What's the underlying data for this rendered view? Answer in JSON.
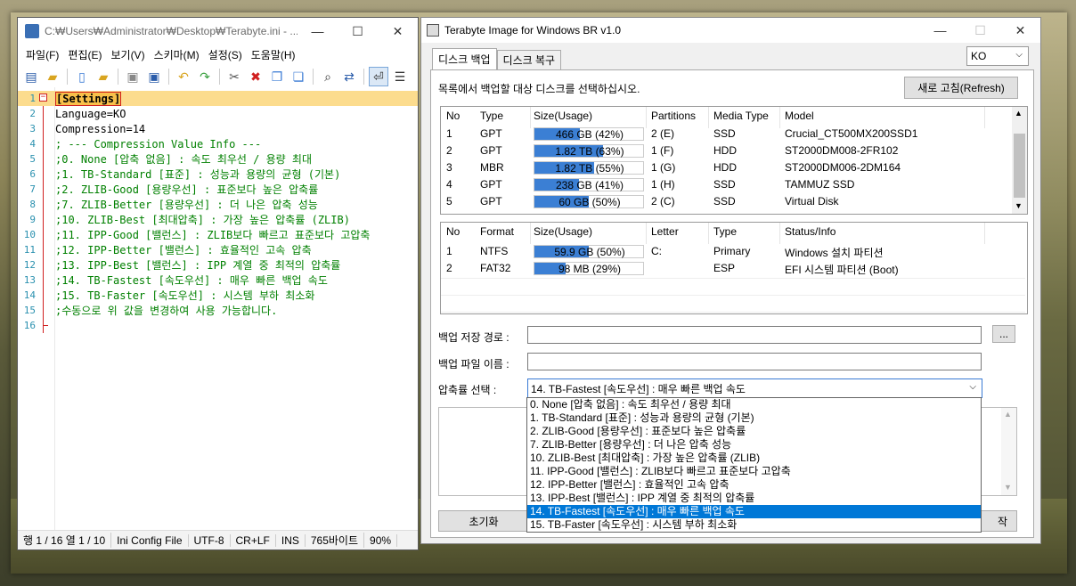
{
  "notepad": {
    "title": "C:₩Users₩Administrator₩Desktop₩Terabyte.ini - ...",
    "menu": [
      "파일(F)",
      "편집(E)",
      "보기(V)",
      "스키마(M)",
      "설정(S)",
      "도움말(H)"
    ],
    "lines": [
      {
        "n": "1",
        "text": "[Settings]"
      },
      {
        "n": "2",
        "text": "Language=KO"
      },
      {
        "n": "3",
        "text": "Compression=14"
      },
      {
        "n": "4",
        "text": "; --- Compression Value Info ---"
      },
      {
        "n": "5",
        "text": ";0. None [압축 없음] : 속도 최우선 / 용량 최대"
      },
      {
        "n": "6",
        "text": ";1. TB-Standard [표준] : 성능과 용량의 균형 (기본)"
      },
      {
        "n": "7",
        "text": ";2. ZLIB-Good [용량우선] : 표준보다 높은 압축률"
      },
      {
        "n": "8",
        "text": ";7. ZLIB-Better [용량우선] : 더 나은 압축 성능"
      },
      {
        "n": "9",
        "text": ";10. ZLIB-Best [최대압축] : 가장 높은 압축률 (ZLIB)"
      },
      {
        "n": "10",
        "text": ";11. IPP-Good [밸런스] : ZLIB보다 빠르고 표준보다 고압축"
      },
      {
        "n": "11",
        "text": ";12. IPP-Better [밸런스] : 효율적인 고속 압축"
      },
      {
        "n": "12",
        "text": ";13. IPP-Best [밸런스] : IPP 계열 중 최적의 압축률"
      },
      {
        "n": "13",
        "text": ";14. TB-Fastest [속도우선] : 매우 빠른 백업 속도"
      },
      {
        "n": "14",
        "text": ";15. TB-Faster [속도우선] : 시스템 부하 최소화"
      },
      {
        "n": "15",
        "text": ";수동으로 위 값을 변경하여 사용 가능합니다."
      },
      {
        "n": "16",
        "text": ""
      }
    ],
    "status": [
      "행 1 / 16  열 1 / 10",
      "Ini Config File",
      "UTF-8",
      "CR+LF",
      "INS",
      "765바이트",
      "90%"
    ]
  },
  "tbi": {
    "title": "Terabyte Image for Windows BR v1.0",
    "tabs": [
      "디스크 백업",
      "디스크 복구"
    ],
    "lang": "KO",
    "instruction": "목록에서 백업할 대상 디스크를 선택하십시오.",
    "refresh": "새로 고침(Refresh)",
    "disk_headers": [
      "No",
      "Type",
      "Size(Usage)",
      "Partitions",
      "Media Type",
      "Model"
    ],
    "disks": [
      {
        "no": "1",
        "type": "GPT",
        "size": "466 GB (42%)",
        "usage": 0.42,
        "parts": "2 (E)",
        "media": "SSD",
        "model": "Crucial_CT500MX200SSD1"
      },
      {
        "no": "2",
        "type": "GPT",
        "size": "1.82 TB (63%)",
        "usage": 0.63,
        "parts": "1 (F)",
        "media": "HDD",
        "model": "ST2000DM008-2FR102"
      },
      {
        "no": "3",
        "type": "MBR",
        "size": "1.82 TB (55%)",
        "usage": 0.55,
        "parts": "1 (G)",
        "media": "HDD",
        "model": "ST2000DM006-2DM164"
      },
      {
        "no": "4",
        "type": "GPT",
        "size": "238 GB (41%)",
        "usage": 0.41,
        "parts": "1 (H)",
        "media": "SSD",
        "model": "TAMMUZ SSD"
      },
      {
        "no": "5",
        "type": "GPT",
        "size": "60 GB (50%)",
        "usage": 0.5,
        "parts": "2 (C)",
        "media": "SSD",
        "model": "Virtual Disk"
      }
    ],
    "part_headers": [
      "No",
      "Format",
      "Size(Usage)",
      "Letter",
      "Type",
      "Status/Info"
    ],
    "parts": [
      {
        "no": "1",
        "fmt": "NTFS",
        "size": "59.9 GB (50%)",
        "usage": 0.5,
        "letter": "C:",
        "type": "Primary",
        "info": "Windows 설치 파티션"
      },
      {
        "no": "2",
        "fmt": "FAT32",
        "size": "98 MB (29%)",
        "usage": 0.29,
        "letter": "",
        "type": "ESP",
        "info": "EFI 시스템 파티션 (Boot)"
      }
    ],
    "path_label": "백업 저장 경로 :",
    "browse": "...",
    "name_label": "백업 파일 이름 :",
    "comp_label": "압축률 선택 :",
    "comp_value": "14. TB-Fastest [속도우선] : 매우 빠른 백업 속도",
    "options": [
      "0. None [압축 없음] : 속도 최우선 / 용량 최대",
      "1. TB-Standard [표준] : 성능과 용량의 균형 (기본)",
      "2. ZLIB-Good [용량우선] : 표준보다 높은 압축률",
      "7. ZLIB-Better [용량우선] : 더 나은 압축 성능",
      "10. ZLIB-Best [최대압축] : 가장 높은 압축률 (ZLIB)",
      "11. IPP-Good [밸런스] : ZLIB보다 빠르고 표준보다 고압축",
      "12. IPP-Better [밸런스] : 효율적인 고속 압축",
      "13. IPP-Best [밸런스] : IPP 계열 중 최적의 압축률",
      "14. TB-Fastest [속도우선] : 매우 빠른 백업 속도",
      "15. TB-Faster [속도우선] : 시스템 부하 최소화"
    ],
    "selected_index": 8,
    "reset": "초기화",
    "start_partial": "작"
  }
}
